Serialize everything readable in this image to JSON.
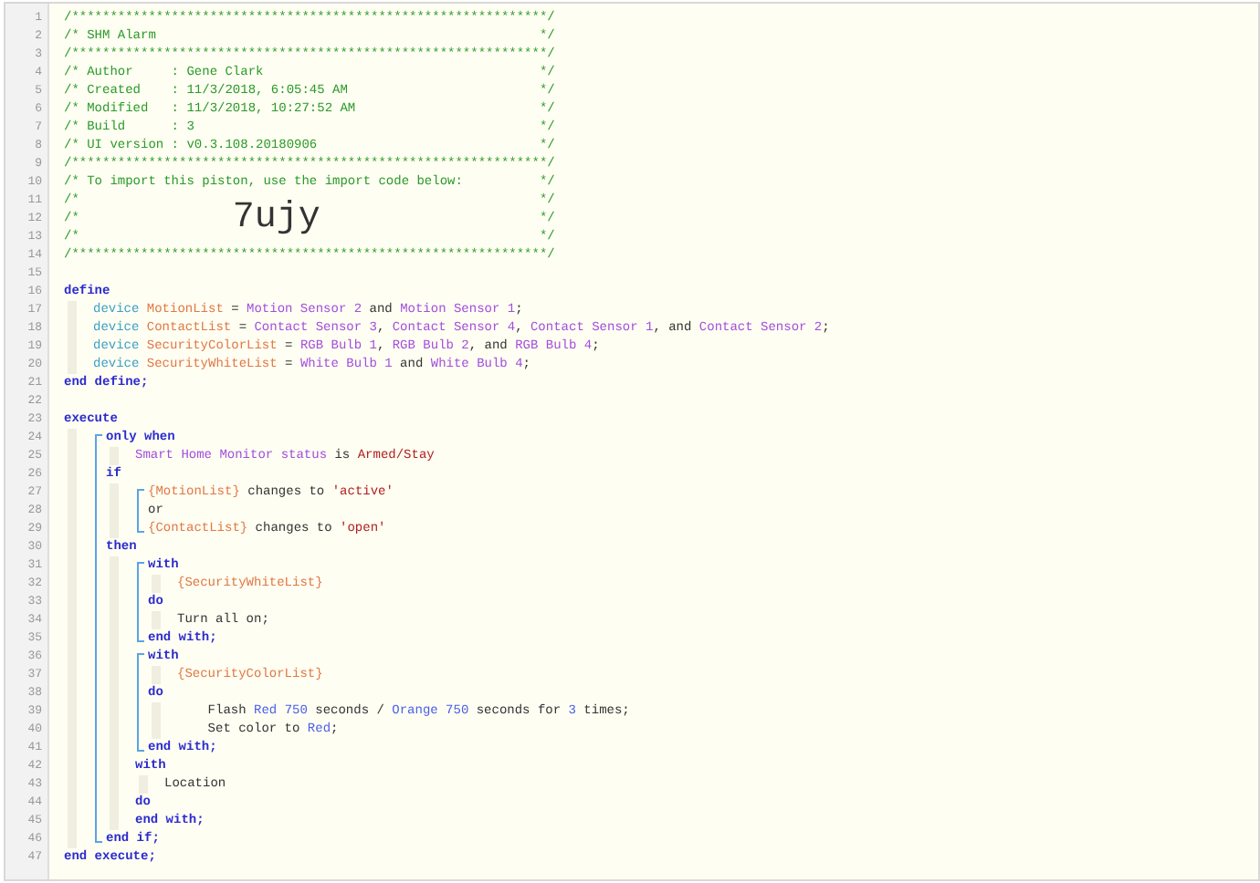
{
  "line_numbers": [
    "1",
    "2",
    "3",
    "4",
    "5",
    "6",
    "7",
    "8",
    "9",
    "10",
    "11",
    "12",
    "13",
    "14",
    "15",
    "16",
    "17",
    "18",
    "19",
    "20",
    "21",
    "22",
    "23",
    "24",
    "25",
    "26",
    "27",
    "28",
    "29",
    "30",
    "31",
    "32",
    "33",
    "34",
    "35",
    "36",
    "37",
    "38",
    "39",
    "40",
    "41",
    "42",
    "43",
    "44",
    "45",
    "46",
    "47"
  ],
  "code": [
    {
      "kind": "comment",
      "text": "/**************************************************************/"
    },
    {
      "kind": "comment",
      "text": "/* SHM Alarm",
      "end": "*/"
    },
    {
      "kind": "comment",
      "text": "/**************************************************************/"
    },
    {
      "kind": "comment",
      "text": "/* Author     : Gene Clark",
      "end": "*/"
    },
    {
      "kind": "comment",
      "text": "/* Created    : 11/3/2018, 6:05:45 AM",
      "end": "*/"
    },
    {
      "kind": "comment",
      "text": "/* Modified   : 11/3/2018, 10:27:52 AM",
      "end": "*/"
    },
    {
      "kind": "comment",
      "text": "/* Build      : 3",
      "end": "*/"
    },
    {
      "kind": "comment",
      "text": "/* UI version : v0.3.108.20180906",
      "end": "*/"
    },
    {
      "kind": "comment",
      "text": "/**************************************************************/"
    },
    {
      "kind": "comment",
      "text": "/* To import this piston, use the import code below:",
      "end": "*/"
    },
    {
      "kind": "comment",
      "text": "/*",
      "end": "*/"
    },
    {
      "kind": "comment",
      "text": "/*",
      "code": "7ujy",
      "end": "*/"
    },
    {
      "kind": "comment",
      "text": "/*",
      "end": "*/"
    },
    {
      "kind": "comment",
      "text": "/**************************************************************/"
    },
    {
      "kind": "blank"
    },
    {
      "kind": "line",
      "tokens": [
        {
          "kind": "keyword",
          "text": "define"
        }
      ]
    },
    {
      "kind": "block",
      "children": [
        {
          "kind": "line",
          "tokens": [
            {
              "kind": "type",
              "text": "device"
            },
            {
              "kind": "variable",
              "text": "MotionList"
            },
            {
              "kind": "plain",
              "text": " = "
            },
            {
              "kind": "device",
              "text": "Motion Sensor 2"
            },
            {
              "kind": "plain",
              "text": " and "
            },
            {
              "kind": "device",
              "text": "Motion Sensor 1"
            },
            {
              "kind": "plain",
              "text": ";"
            }
          ]
        },
        {
          "kind": "line",
          "tokens": [
            {
              "kind": "type",
              "text": "device"
            },
            {
              "kind": "variable",
              "text": "ContactList"
            },
            {
              "kind": "plain",
              "text": " = "
            },
            {
              "kind": "device",
              "text": "Contact Sensor 3"
            },
            {
              "kind": "plain",
              "text": ", "
            },
            {
              "kind": "device",
              "text": "Contact Sensor 4"
            },
            {
              "kind": "plain",
              "text": ", "
            },
            {
              "kind": "device",
              "text": "Contact Sensor 1"
            },
            {
              "kind": "plain",
              "text": ", and "
            },
            {
              "kind": "device",
              "text": "Contact Sensor 2"
            },
            {
              "kind": "plain",
              "text": ";"
            }
          ]
        },
        {
          "kind": "line",
          "tokens": [
            {
              "kind": "type",
              "text": "device"
            },
            {
              "kind": "variable",
              "text": "SecurityColorList"
            },
            {
              "kind": "plain",
              "text": " = "
            },
            {
              "kind": "device",
              "text": "RGB Bulb 1"
            },
            {
              "kind": "plain",
              "text": ", "
            },
            {
              "kind": "device",
              "text": "RGB Bulb 2"
            },
            {
              "kind": "plain",
              "text": ", and "
            },
            {
              "kind": "device",
              "text": "RGB Bulb 4"
            },
            {
              "kind": "plain",
              "text": ";"
            }
          ]
        },
        {
          "kind": "line",
          "tokens": [
            {
              "kind": "type",
              "text": "device"
            },
            {
              "kind": "variable",
              "text": "SecurityWhiteList"
            },
            {
              "kind": "plain",
              "text": " = "
            },
            {
              "kind": "device",
              "text": "White Bulb 1"
            },
            {
              "kind": "plain",
              "text": " and "
            },
            {
              "kind": "device",
              "text": "White Bulb 4"
            },
            {
              "kind": "plain",
              "text": ";"
            }
          ]
        }
      ]
    },
    {
      "kind": "line",
      "tokens": [
        {
          "kind": "keyword",
          "text": "end define;"
        }
      ]
    },
    {
      "kind": "blank"
    },
    {
      "kind": "line",
      "tokens": [
        {
          "kind": "keyword",
          "text": "execute"
        }
      ]
    },
    {
      "kind": "block",
      "children": [
        {
          "kind": "bracket",
          "children": [
            {
              "kind": "line",
              "tokens": [
                {
                  "kind": "keyword",
                  "text": "only when"
                }
              ]
            },
            {
              "kind": "block",
              "children": [
                {
                  "kind": "line",
                  "tokens": [
                    {
                      "kind": "device",
                      "text": "Smart Home Monitor status"
                    },
                    {
                      "kind": "plain",
                      "text": " is "
                    },
                    {
                      "kind": "string",
                      "text": "Armed/Stay"
                    }
                  ]
                }
              ]
            },
            {
              "kind": "line",
              "tokens": [
                {
                  "kind": "keyword",
                  "text": "if"
                }
              ]
            },
            {
              "kind": "block",
              "children": [
                {
                  "kind": "bracket",
                  "children": [
                    {
                      "kind": "line",
                      "tokens": [
                        {
                          "kind": "variable",
                          "text": "{MotionList}"
                        },
                        {
                          "kind": "plain",
                          "text": " changes to "
                        },
                        {
                          "kind": "string",
                          "text": "'active'"
                        }
                      ]
                    },
                    {
                      "kind": "line",
                      "tokens": [
                        {
                          "kind": "plain",
                          "text": "or"
                        }
                      ]
                    },
                    {
                      "kind": "line",
                      "tokens": [
                        {
                          "kind": "variable",
                          "text": "{ContactList}"
                        },
                        {
                          "kind": "plain",
                          "text": " changes to "
                        },
                        {
                          "kind": "string",
                          "text": "'open'"
                        }
                      ]
                    }
                  ]
                }
              ]
            },
            {
              "kind": "line",
              "tokens": [
                {
                  "kind": "keyword",
                  "text": "then"
                }
              ]
            },
            {
              "kind": "block",
              "children": [
                {
                  "kind": "bracket",
                  "children": [
                    {
                      "kind": "line",
                      "tokens": [
                        {
                          "kind": "keyword",
                          "text": "with"
                        }
                      ]
                    },
                    {
                      "kind": "block",
                      "children": [
                        {
                          "kind": "line",
                          "tokens": [
                            {
                              "kind": "variable",
                              "text": "{SecurityWhiteList}"
                            }
                          ]
                        }
                      ]
                    },
                    {
                      "kind": "line",
                      "tokens": [
                        {
                          "kind": "keyword",
                          "text": "do"
                        }
                      ]
                    },
                    {
                      "kind": "block",
                      "children": [
                        {
                          "kind": "line",
                          "tokens": [
                            {
                              "kind": "plain",
                              "text": "Turn all on;"
                            }
                          ]
                        }
                      ]
                    },
                    {
                      "kind": "line",
                      "tokens": [
                        {
                          "kind": "keyword",
                          "text": "end with;"
                        }
                      ]
                    }
                  ]
                },
                {
                  "kind": "bracket",
                  "children": [
                    {
                      "kind": "line",
                      "tokens": [
                        {
                          "kind": "keyword",
                          "text": "with"
                        }
                      ]
                    },
                    {
                      "kind": "block",
                      "children": [
                        {
                          "kind": "line",
                          "tokens": [
                            {
                              "kind": "variable",
                              "text": "{SecurityColorList}"
                            }
                          ]
                        }
                      ]
                    },
                    {
                      "kind": "line",
                      "tokens": [
                        {
                          "kind": "keyword",
                          "text": "do"
                        }
                      ]
                    },
                    {
                      "kind": "block",
                      "children": [
                        {
                          "kind": "line",
                          "tokens": [
                            {
                              "kind": "plain",
                              "text": "    Flash "
                            },
                            {
                              "kind": "literal",
                              "text": "Red 750"
                            },
                            {
                              "kind": "plain",
                              "text": " seconds / "
                            },
                            {
                              "kind": "literal",
                              "text": "Orange 750"
                            },
                            {
                              "kind": "plain",
                              "text": " seconds for "
                            },
                            {
                              "kind": "literal",
                              "text": "3"
                            },
                            {
                              "kind": "plain",
                              "text": " times;"
                            }
                          ]
                        },
                        {
                          "kind": "line",
                          "tokens": [
                            {
                              "kind": "plain",
                              "text": "    Set color to "
                            },
                            {
                              "kind": "literal",
                              "text": "Red"
                            },
                            {
                              "kind": "plain",
                              "text": ";"
                            }
                          ]
                        }
                      ]
                    },
                    {
                      "kind": "line",
                      "tokens": [
                        {
                          "kind": "keyword",
                          "text": "end with;"
                        }
                      ]
                    }
                  ]
                },
                {
                  "kind": "line",
                  "tokens": [
                    {
                      "kind": "keyword",
                      "text": "with"
                    }
                  ]
                },
                {
                  "kind": "block",
                  "children": [
                    {
                      "kind": "line",
                      "tokens": [
                        {
                          "kind": "plain",
                          "text": "Location"
                        }
                      ]
                    }
                  ]
                },
                {
                  "kind": "line",
                  "tokens": [
                    {
                      "kind": "keyword",
                      "text": "do"
                    }
                  ]
                },
                {
                  "kind": "line",
                  "tokens": [
                    {
                      "kind": "keyword",
                      "text": "end with;"
                    }
                  ]
                }
              ]
            },
            {
              "kind": "line",
              "tokens": [
                {
                  "kind": "keyword",
                  "text": "end if;"
                }
              ]
            }
          ]
        }
      ]
    },
    {
      "kind": "line",
      "tokens": [
        {
          "kind": "keyword",
          "text": "end execute;"
        }
      ]
    }
  ]
}
